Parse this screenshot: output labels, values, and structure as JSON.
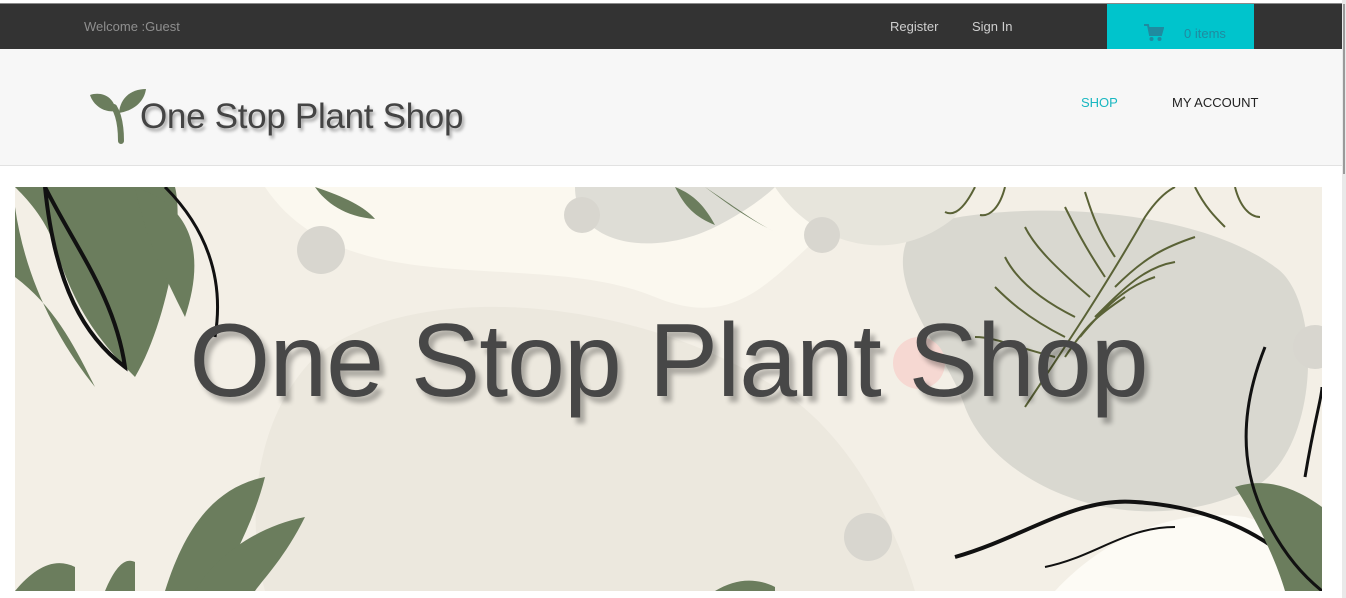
{
  "topbar": {
    "welcome": "Welcome :Guest",
    "register_label": "Register",
    "signin_label": "Sign In",
    "cart": {
      "icon": "shopping-cart-icon",
      "count_label": "0 items"
    }
  },
  "header": {
    "logo_text": "One Stop Plant Shop",
    "logo_icon": "sprout-icon",
    "nav": {
      "shop": "SHOP",
      "my_account": "MY ACCOUNT"
    }
  },
  "hero": {
    "title": "One Stop Plant Shop"
  },
  "colors": {
    "topbar_bg": "#333333",
    "cart_bg": "#00c4cc",
    "nav_active": "#19b7c1",
    "leaf_green": "#6b7d5d",
    "hero_bg": "#f3efe6"
  }
}
